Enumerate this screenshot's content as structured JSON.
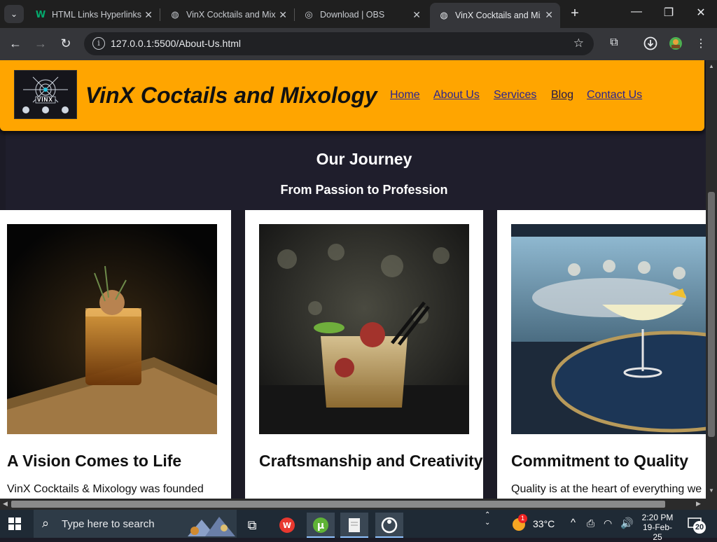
{
  "browser": {
    "tabs": [
      {
        "title": "HTML Links Hyperlinks",
        "icon": "w3schools-icon",
        "active": false
      },
      {
        "title": "VinX Cocktails and Mix",
        "icon": "globe-icon",
        "active": false
      },
      {
        "title": "Download | OBS",
        "icon": "obs-icon",
        "active": false
      },
      {
        "title": "VinX Cocktails and Mix",
        "icon": "globe-icon",
        "active": true
      }
    ],
    "url": "127.0.0.1:5500/About-Us.html"
  },
  "site": {
    "brand": "VinX Coctails and Mixology",
    "logo_text": "VINX",
    "nav": [
      "Home",
      "About Us",
      "Services",
      "Blog",
      "Contact Us"
    ],
    "current_nav": "Blog",
    "header_color": "#ffa500"
  },
  "hero": {
    "title": "Our Journey",
    "subtitle": "From Passion to Profession"
  },
  "cards": [
    {
      "title": "A Vision Comes to Life",
      "text": "VinX Cocktails & Mixology was founded"
    },
    {
      "title": "Craftsmanship and Creativity",
      "text": ""
    },
    {
      "title": "Commitment to Quality",
      "text": "Quality is at the heart of everything we"
    }
  ],
  "taskbar": {
    "search_placeholder": "Type here to search",
    "weather": "33°C",
    "weather_badge": "1",
    "time": "2:20 PM",
    "date": "19-Feb-25",
    "notifications": "20"
  }
}
